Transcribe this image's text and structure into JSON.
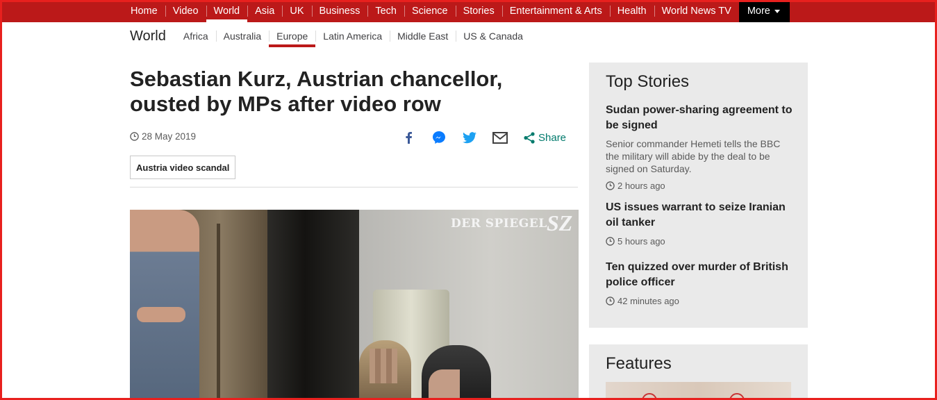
{
  "topnav": {
    "items": [
      "Home",
      "Video",
      "World",
      "Asia",
      "UK",
      "Business",
      "Tech",
      "Science",
      "Stories",
      "Entertainment & Arts",
      "Health",
      "World News TV"
    ],
    "active": "World",
    "more_label": "More"
  },
  "subnav": {
    "section_title": "World",
    "items": [
      "Africa",
      "Australia",
      "Europe",
      "Latin America",
      "Middle East",
      "US & Canada"
    ],
    "active": "Europe"
  },
  "article": {
    "headline": "Sebastian Kurz, Austrian chancellor, ousted by MPs after video row",
    "date": "28 May 2019",
    "share_label": "Share",
    "share_icons": [
      "facebook-icon",
      "messenger-icon",
      "twitter-icon",
      "email-icon",
      "share-icon"
    ],
    "tag": "Austria video scandal",
    "image_watermarks": [
      "DER SPIEGEL",
      "SZ"
    ]
  },
  "sidebar": {
    "top_stories_title": "Top Stories",
    "stories": [
      {
        "title": "Sudan power-sharing agreement to be signed",
        "summary": "Senior commander Hemeti tells the BBC the military will abide by the deal to be signed on Saturday.",
        "time": "2 hours ago"
      },
      {
        "title": "US issues warrant to seize Iranian oil tanker",
        "summary": "",
        "time": "5 hours ago"
      },
      {
        "title": "Ten quizzed over murder of British police officer",
        "summary": "",
        "time": "42 minutes ago"
      }
    ],
    "features_title": "Features"
  },
  "colors": {
    "brand_red": "#bb1919",
    "frame_red": "#e8201e",
    "share_green": "#007a6c",
    "sidebar_bg": "#eaeaea"
  }
}
